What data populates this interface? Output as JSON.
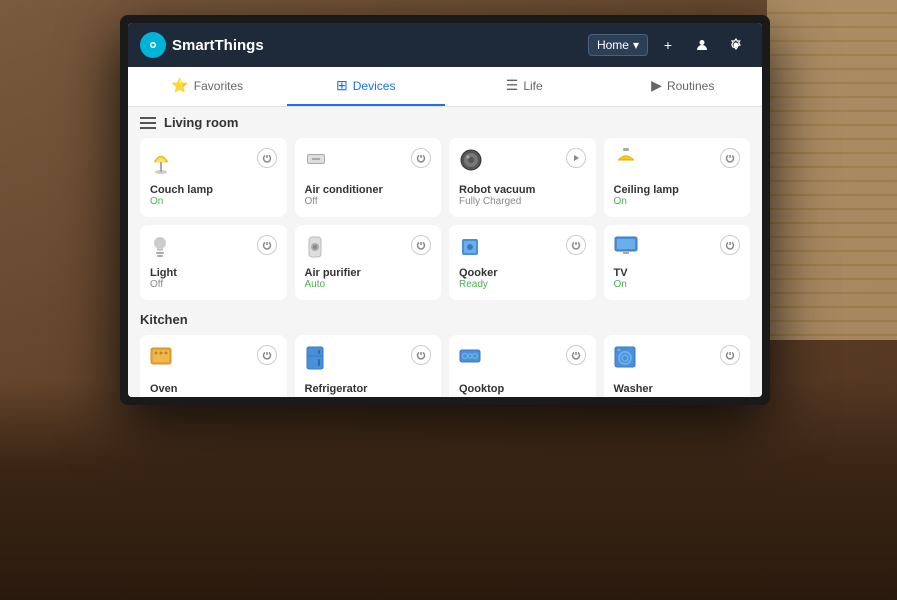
{
  "app": {
    "brand": "SmartThings",
    "logo_symbol": "✦"
  },
  "header": {
    "home_label": "Home",
    "add_icon": "+",
    "user_icon": "👤",
    "settings_icon": "⚙"
  },
  "nav": {
    "tabs": [
      {
        "id": "favorites",
        "label": "Favorites",
        "icon": "⭐",
        "active": false
      },
      {
        "id": "devices",
        "label": "Devices",
        "icon": "⊞",
        "active": true
      },
      {
        "id": "life",
        "label": "Life",
        "icon": "☰",
        "active": false
      },
      {
        "id": "routines",
        "label": "Routines",
        "icon": "▶",
        "active": false
      }
    ]
  },
  "sections": [
    {
      "id": "living-room",
      "title": "Living room",
      "devices": [
        {
          "id": "couch-lamp",
          "name": "Couch lamp",
          "status": "On",
          "status_type": "on",
          "icon": "🪔",
          "control": "power"
        },
        {
          "id": "air-conditioner",
          "name": "Air conditioner",
          "status": "Off",
          "status_type": "off",
          "icon": "🌡",
          "control": "power"
        },
        {
          "id": "robot-vacuum",
          "name": "Robot vacuum",
          "status": "Fully Charged",
          "status_type": "off",
          "icon": "🤖",
          "control": "play"
        },
        {
          "id": "ceiling-lamp",
          "name": "Ceiling lamp",
          "status": "On",
          "status_type": "on",
          "icon": "💡",
          "control": "power"
        },
        {
          "id": "light",
          "name": "Light",
          "status": "Off",
          "status_type": "off",
          "icon": "💡",
          "control": "power"
        },
        {
          "id": "air-purifier",
          "name": "Air purifier",
          "status": "Auto",
          "status_type": "on",
          "icon": "🌀",
          "control": "power"
        },
        {
          "id": "qooker",
          "name": "Qooker",
          "status": "Ready",
          "status_type": "on",
          "icon": "🟦",
          "control": "power"
        },
        {
          "id": "tv",
          "name": "TV",
          "status": "On",
          "status_type": "on",
          "icon": "📺",
          "control": "power"
        }
      ]
    },
    {
      "id": "kitchen",
      "title": "Kitchen",
      "devices": [
        {
          "id": "oven",
          "name": "Oven",
          "status": "",
          "status_type": "off",
          "icon": "🟧",
          "control": "power"
        },
        {
          "id": "refrigerator",
          "name": "Refrigerator",
          "status": "",
          "status_type": "off",
          "icon": "🗄",
          "control": "power"
        },
        {
          "id": "qooktop",
          "name": "Qooktop",
          "status": "",
          "status_type": "off",
          "icon": "🟦",
          "control": "power"
        },
        {
          "id": "washer",
          "name": "Washer",
          "status": "",
          "status_type": "off",
          "icon": "🌊",
          "control": "power"
        }
      ]
    }
  ],
  "icons": {
    "couch_lamp": "🪔",
    "air_conditioner": "❄",
    "robot_vacuum": "🔵",
    "ceiling_lamp": "💡",
    "light": "💡",
    "air_purifier": "💨",
    "qooker": "🟦",
    "tv": "📺",
    "oven": "🟧",
    "refrigerator": "🗄",
    "qooktop": "🍳",
    "washer": "🔷"
  }
}
